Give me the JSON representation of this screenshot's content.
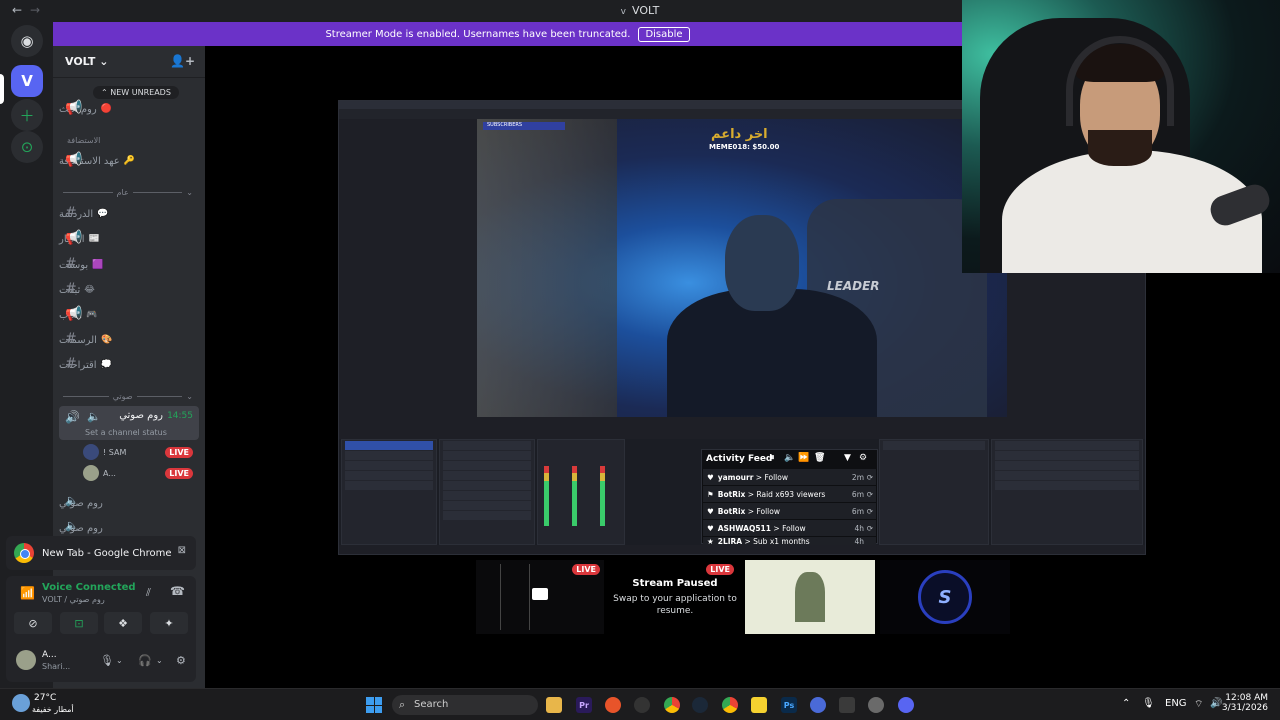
{
  "titlebar": {
    "back": "←",
    "forward": "→",
    "logo": "v",
    "title": "VOLT"
  },
  "banner": {
    "text": "Streamer Mode is enabled. Usernames have been truncated.",
    "button": "Disable"
  },
  "server": {
    "name": "VOLT ⌄"
  },
  "unreads": "⌃ NEW UNREADS",
  "channels_top": [
    {
      "name": "روم البث",
      "emoji": "🔴"
    }
  ],
  "categories": {
    "guests": "الاستضافة",
    "general": "عام",
    "voice": "صوتي"
  },
  "guest_channel": {
    "name": "عهد الاستضافة",
    "emoji": "🔑"
  },
  "text_channels": [
    {
      "name": "الدردشة",
      "emoji": "💬"
    },
    {
      "name": "الأخبار",
      "emoji": "📰"
    },
    {
      "name": "بوستت",
      "emoji": "🟪"
    },
    {
      "name": "ثبتات",
      "emoji": "😂"
    },
    {
      "name": "العاب",
      "emoji": "🎮"
    },
    {
      "name": "الرسمات",
      "emoji": "🎨"
    },
    {
      "name": "اقتراحات",
      "emoji": "💭"
    }
  ],
  "voice_active": {
    "name": "روم صوتي",
    "time": "14:55",
    "status": "Set a channel status"
  },
  "members": [
    {
      "name": "! SAM",
      "badge": "LIVE"
    },
    {
      "name": "A...",
      "badge": "LIVE"
    }
  ],
  "voice_channels": [
    "روم صوتي",
    "روم صوتي"
  ],
  "popup": {
    "text": "New Tab - Google Chrome"
  },
  "voicepanel": {
    "title": "Voice Connected",
    "sub": "روم صوتي / VOLT"
  },
  "user": {
    "name": "A...",
    "status": "Shari..."
  },
  "stream": {
    "subscribers_bar": "SUBSCRIBERS",
    "last_supporter_label": "اخر داعم",
    "last_supporter_value": "MEME018: $50.00",
    "chair_brand": "LEADER"
  },
  "activity_feed": {
    "title": "Activity Feed",
    "rows": [
      {
        "user": "yamourr",
        "event": "Follow",
        "ago": "2m"
      },
      {
        "user": "BotRix",
        "event": "Raid x693 viewers",
        "ago": "6m"
      },
      {
        "user": "BotRix",
        "event": "Follow",
        "ago": "6m"
      },
      {
        "user": "ASHWAQ511",
        "event": "Follow",
        "ago": "4h"
      },
      {
        "user": "2LIRA",
        "event": "Sub x1 months",
        "ago": "4h"
      }
    ]
  },
  "tiles": {
    "live": "LIVE",
    "paused_title": "Stream Paused",
    "paused_sub": "Swap to your application to resume."
  },
  "taskbar": {
    "temp": "27°C",
    "weather": "أمطار خفيفة",
    "search": "Search",
    "lang": "ENG",
    "time": "12:08 AM",
    "date": "3/31/2026"
  },
  "colors": {
    "accent": "#5865f2",
    "banner": "#6b32c8",
    "live": "#da373c",
    "connected": "#23a55a"
  }
}
